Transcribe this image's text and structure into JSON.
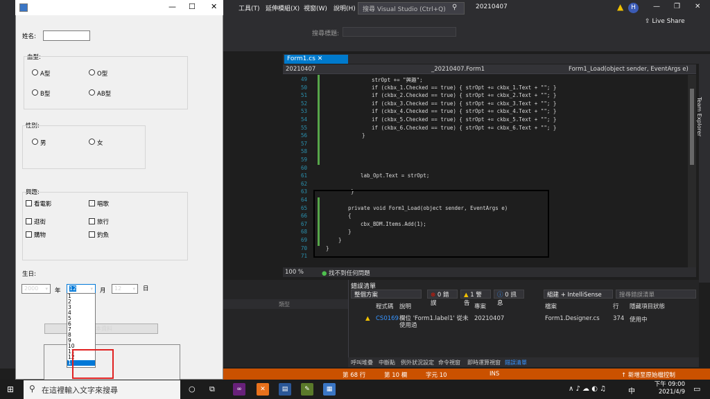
{
  "vs": {
    "menu": [
      "工具(T)",
      "延伸模組(X)",
      "視窗(W)",
      "說明(H)"
    ],
    "search_placeholder": "搜尋 Visual Studio (Ctrl+Q)",
    "solution_name": "20210407",
    "avatar_letter": "H",
    "live_share": "Live Share",
    "search_label": "搜尋標題:",
    "team_explorer": "Team Explorer"
  },
  "editor": {
    "tab_label": "Form1.cs",
    "nav_project": "20210407",
    "nav_class": "_20210407.Form1",
    "nav_member": "Form1_Load(object sender, EventArgs e)",
    "zoom": "100 %",
    "issues": "找不到任何問題",
    "lines": [
      {
        "n": "49",
        "t": "strOpt += \"興趣\";"
      },
      {
        "n": "50",
        "t": "if (ckbx_1.Checked == true) { strOpt += ckbx_1.Text + \"\"; }"
      },
      {
        "n": "51",
        "t": "if (ckbx_2.Checked == true) { strOpt += ckbx_2.Text + \"\"; }"
      },
      {
        "n": "52",
        "t": "if (ckbx_3.Checked == true) { strOpt += ckbx_3.Text + \"\"; }"
      },
      {
        "n": "53",
        "t": "if (ckbx_4.Checked == true) { strOpt += ckbx_4.Text + \"\"; }"
      },
      {
        "n": "54",
        "t": "if (ckbx_5.Checked == true) { strOpt += ckbx_5.Text + \"\"; }"
      },
      {
        "n": "55",
        "t": "if (ckbx_6.Checked == true) { strOpt += ckbx_6.Text + \"\"; }"
      },
      {
        "n": "56",
        "t": "}"
      },
      {
        "n": "57",
        "t": ""
      },
      {
        "n": "58",
        "t": ""
      },
      {
        "n": "59",
        "t": ""
      },
      {
        "n": "60",
        "t": ""
      },
      {
        "n": "61",
        "t": "lab_Opt.Text = strOpt;"
      },
      {
        "n": "62",
        "t": ""
      },
      {
        "n": "63",
        "t": "}"
      },
      {
        "n": "64",
        "t": ""
      },
      {
        "n": "65",
        "t": "private void Form1_Load(object sender, EventArgs e)"
      },
      {
        "n": "66",
        "t": "{"
      },
      {
        "n": "67",
        "t": "cbx_BDM.Items.Add(1);"
      },
      {
        "n": "68",
        "t": "}"
      },
      {
        "n": "69",
        "t": "}"
      },
      {
        "n": "70",
        "t": "}"
      },
      {
        "n": "71",
        "t": ""
      }
    ]
  },
  "errors": {
    "title": "錯誤清單",
    "scope": "整個方案",
    "err_count": "0 錯誤",
    "warn_count": "1 警告",
    "msg_count": "0 訊息",
    "build_filter": "組建 + IntelliSense",
    "search_placeholder": "搜尋錯誤清單",
    "columns": [
      "程式碼",
      "說明",
      "專案",
      "檔案",
      "行",
      "隱藏項目狀態"
    ],
    "row": {
      "code": "CS0169",
      "desc": "欄位 'Form1.label1' 從未使用過",
      "project": "20210407",
      "file": "Form1.Designer.cs",
      "line": "374",
      "state": "使用中"
    },
    "left_panel_col": "類型"
  },
  "bottom_tabs": [
    "呼叫堆疊",
    "中斷點",
    "例外狀況設定",
    "命令視窗",
    "即時運算視窗",
    "錯誤清單"
  ],
  "status": {
    "line": "第 68 行",
    "col": "第 10 欄",
    "ch": "字元 10",
    "ins": "INS",
    "source": "新增至原始檔控制"
  },
  "form": {
    "name_label": "姓名:",
    "blood_label": "血型:",
    "blood": [
      "A型",
      "O型",
      "B型",
      "AB型"
    ],
    "gender_label": "性別:",
    "gender": [
      "男",
      "女"
    ],
    "hobby_label": "興趣:",
    "hobbies": [
      {
        "label": "看電影",
        "checked": false
      },
      {
        "label": "唱歌",
        "checked": true
      },
      {
        "label": "逛街",
        "checked": false
      },
      {
        "label": "旅行",
        "checked": false
      },
      {
        "label": "購物",
        "checked": false
      },
      {
        "label": "釣魚",
        "checked": false
      }
    ],
    "birth_label": "生日:",
    "year_value": "2000",
    "year_unit": "年",
    "month_value": "12",
    "month_unit": "月",
    "day_value": "12",
    "day_unit": "日",
    "month_options": [
      "1",
      "2",
      "3",
      "4",
      "5",
      "6",
      "7",
      "8",
      "9",
      "10",
      "11",
      "12",
      "1"
    ],
    "button_label": "基本資料"
  },
  "taskbar": {
    "search_placeholder": "在這裡輸入文字來搜尋",
    "time": "下午 09:00",
    "date": "2021/4/9",
    "ime": "中"
  }
}
